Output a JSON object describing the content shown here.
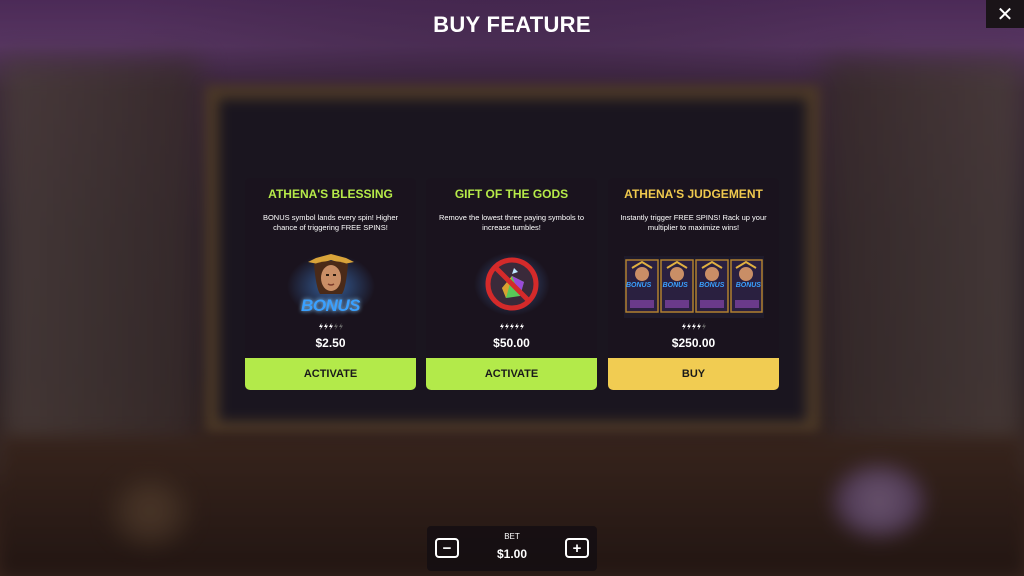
{
  "header": {
    "title": "BUY FEATURE",
    "close_symbol": "✕"
  },
  "cards": [
    {
      "title": "ATHENA'S BLESSING",
      "description": "BONUS symbol lands every spin! Higher chance of triggering FREE SPINS!",
      "volatility": 3,
      "volatility_max": 5,
      "price": "$2.50",
      "button": "ACTIVATE",
      "accent": "#b6ea49",
      "art_icon": "athena-bonus-icon",
      "art_text": "BONUS"
    },
    {
      "title": "GIFT OF THE GODS",
      "description": "Remove the lowest three paying symbols to increase tumbles!",
      "volatility": 5,
      "volatility_max": 5,
      "price": "$50.00",
      "button": "ACTIVATE",
      "accent": "#b6ea49",
      "art_icon": "no-gems-icon"
    },
    {
      "title": "ATHENA'S JUDGEMENT",
      "description": "Instantly trigger FREE SPINS! Rack up your multiplier to maximize wins!",
      "volatility": 4,
      "volatility_max": 5,
      "price": "$250.00",
      "button": "BUY",
      "accent": "#f0c94e",
      "art_icon": "four-bonus-symbols-icon",
      "art_text": "BONUS"
    }
  ],
  "bet": {
    "label": "BET",
    "value": "$1.00",
    "minus": "−",
    "plus": "+"
  }
}
